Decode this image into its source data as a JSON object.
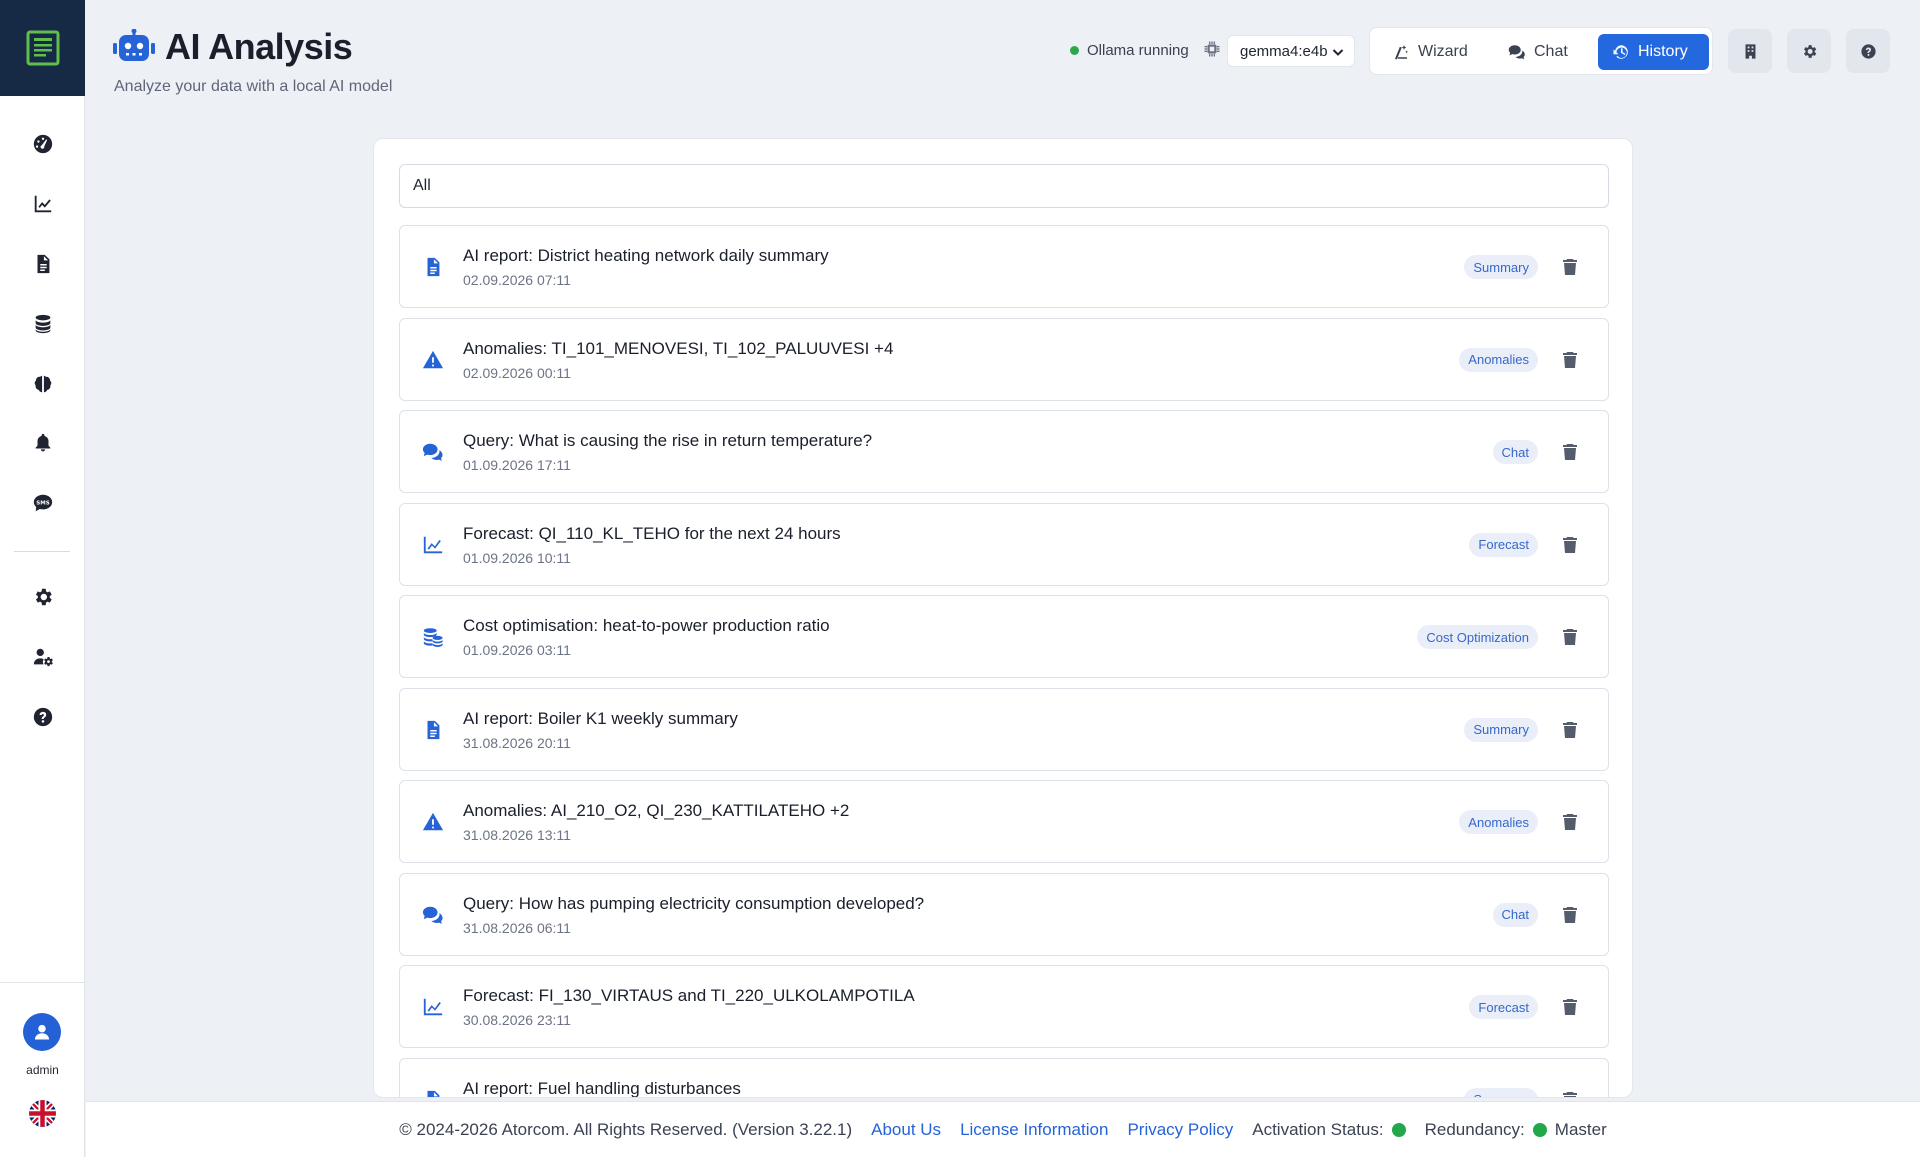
{
  "header": {
    "title": "AI Analysis",
    "subtitle": "Analyze your data with a local AI model",
    "status_text": "Ollama running",
    "model": "gemma4:e4b"
  },
  "tabs": [
    {
      "label": "Wizard",
      "icon": "wizard-icon",
      "active": false
    },
    {
      "label": "Chat",
      "icon": "chat-icon",
      "active": false
    },
    {
      "label": "History",
      "icon": "history-icon",
      "active": true
    }
  ],
  "filter": {
    "value": "All"
  },
  "history": [
    {
      "icon": "document-icon",
      "title": "AI report: District heating network daily summary",
      "date": "02.09.2026 07:11",
      "badge": "Summary"
    },
    {
      "icon": "warning-icon",
      "title": "Anomalies: TI_101_MENOVESI, TI_102_PALUUVESI +4",
      "date": "02.09.2026 00:11",
      "badge": "Anomalies"
    },
    {
      "icon": "chat-icon",
      "title": "Query: What is causing the rise in return temperature?",
      "date": "01.09.2026 17:11",
      "badge": "Chat"
    },
    {
      "icon": "chart-line-icon",
      "title": "Forecast: QI_110_KL_TEHO for the next 24 hours",
      "date": "01.09.2026 10:11",
      "badge": "Forecast"
    },
    {
      "icon": "coins-icon",
      "title": "Cost optimisation: heat-to-power production ratio",
      "date": "01.09.2026 03:11",
      "badge": "Cost Optimization"
    },
    {
      "icon": "document-icon",
      "title": "AI report: Boiler K1 weekly summary",
      "date": "31.08.2026 20:11",
      "badge": "Summary"
    },
    {
      "icon": "warning-icon",
      "title": "Anomalies: AI_210_O2, QI_230_KATTILATEHO +2",
      "date": "31.08.2026 13:11",
      "badge": "Anomalies"
    },
    {
      "icon": "chat-icon",
      "title": "Query: How has pumping electricity consumption developed?",
      "date": "31.08.2026 06:11",
      "badge": "Chat"
    },
    {
      "icon": "chart-line-icon",
      "title": "Forecast: FI_130_VIRTAUS and TI_220_ULKOLAMPOTILA",
      "date": "30.08.2026 23:11",
      "badge": "Forecast"
    },
    {
      "icon": "document-icon",
      "title": "AI report: Fuel handling disturbances",
      "date": "",
      "badge": "Summary"
    }
  ],
  "user": {
    "name": "admin"
  },
  "footer": {
    "copyright": "© 2024-2026 Atorcom. All Rights Reserved. (Version 3.22.1)",
    "about": "About Us",
    "license": "License Information",
    "privacy": "Privacy Policy",
    "activation_label": "Activation Status:",
    "redundancy_label": "Redundancy:",
    "redundancy_value": "Master"
  },
  "colors": {
    "accent": "#2468e0",
    "ok": "#22a84a",
    "logo_bg": "#162a45"
  }
}
